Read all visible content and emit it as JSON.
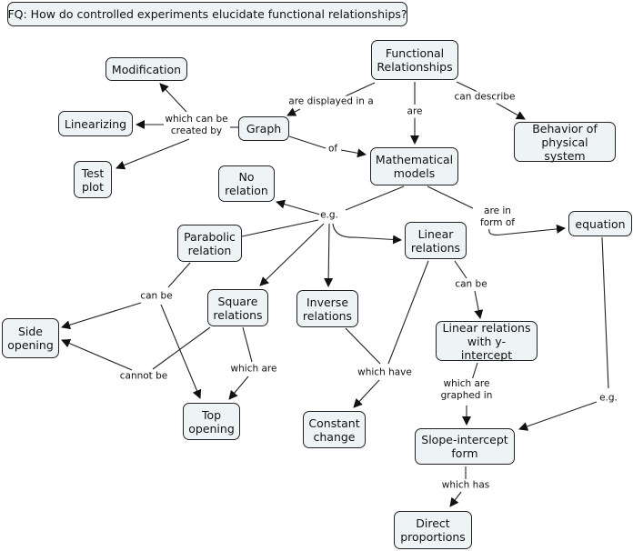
{
  "focus_question": "FQ: How do controlled experiments elucidate functional relationships?",
  "nodes": {
    "functional_relationships": "Functional\nRelationships",
    "graph": "Graph",
    "modification": "Modification",
    "linearizing": "Linearizing",
    "test_plot": "Test\nplot",
    "mathematical_models": "Mathematical\nmodels",
    "behavior": "Behavior of\nphysical system",
    "no_relation": "No\nrelation",
    "parabolic": "Parabolic\nrelation",
    "square": "Square\nrelations",
    "inverse": "Inverse\nrelations",
    "linear": "Linear\nrelations",
    "equation": "equation",
    "side_opening": "Side\nopening",
    "top_opening": "Top\nopening",
    "linear_y": "Linear relations\nwith y-intercept",
    "constant_change": "Constant\nchange",
    "slope_intercept": "Slope-intercept\nform",
    "direct": "Direct\nproportions"
  },
  "links": {
    "displayed_in": "are displayed in a",
    "are": "are",
    "can_describe": "can describe",
    "created_by": "which can be\ncreated by",
    "of": "of",
    "eg_models": "e.g.",
    "form_of": "are in\nform of",
    "can_be_parabolic": "can be",
    "cannot_be": "cannot be",
    "which_are_square": "which are",
    "which_have": "which have",
    "can_be_linear": "can be",
    "graphed_in": "which are\ngraphed in",
    "eg_equation": "e.g.",
    "which_has": "which has"
  },
  "colors": {
    "node_fill": "#eef3f6",
    "stroke": "#222222"
  }
}
